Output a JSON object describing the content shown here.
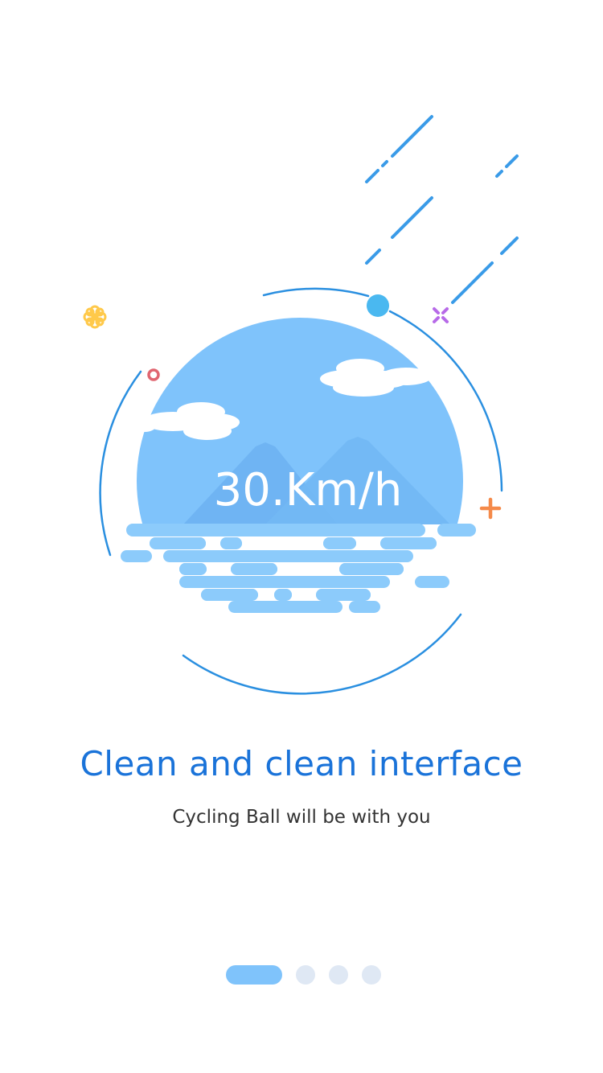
{
  "illustration": {
    "speed_label": "30.Km/h",
    "colors": {
      "sky": "#7fc3fb",
      "cloud": "#ffffff",
      "mountain": "#6eb3f2",
      "water": "#8ccbfb",
      "ring": "#2a8fe0",
      "meteor": "#3a9be8",
      "accent_dot": "#4ab8f0",
      "flower": "#ffc94a",
      "small_ring": "#e06570",
      "cross": "#b76ae8",
      "plus": "#f58a4a"
    },
    "icons": [
      "flower-icon",
      "ring-icon",
      "cross-icon",
      "plus-icon",
      "orbit-dot-icon"
    ]
  },
  "onboarding": {
    "title": "Clean and clean interface",
    "subtitle": "Cycling Ball will be with you",
    "page_index": 1,
    "page_count": 4
  },
  "colors": {
    "title": "#1a73d9",
    "subtitle": "#333333",
    "dot_active": "#7fc3fb",
    "dot_inactive": "#dfe8f4"
  }
}
